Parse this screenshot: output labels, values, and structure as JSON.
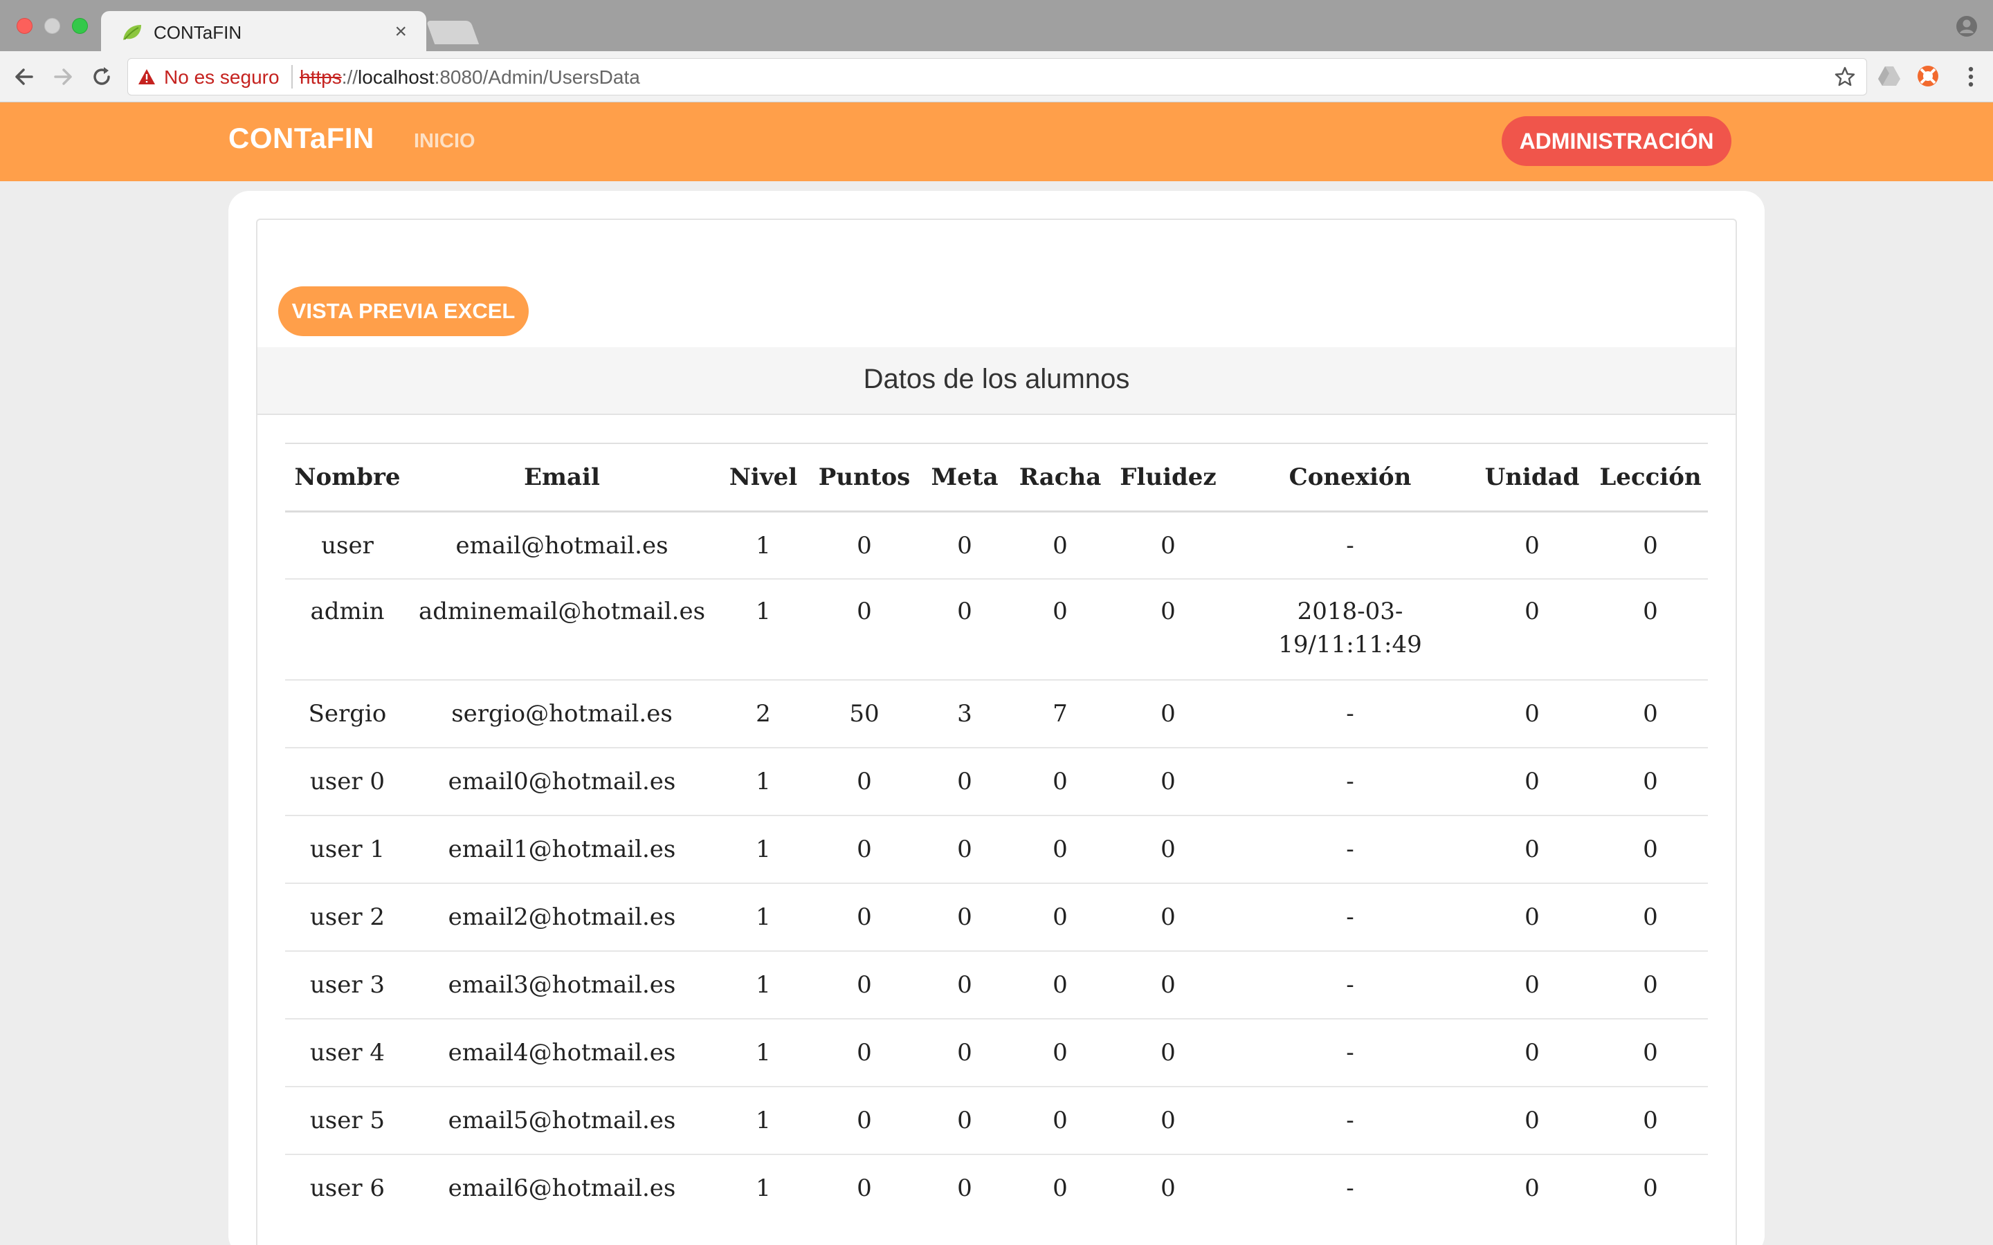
{
  "browser": {
    "tab_title": "CONTaFIN",
    "tab_close": "×",
    "security_label": "No es seguro",
    "url_scheme": "https",
    "url_sep": "://",
    "url_host": "localhost",
    "url_rest": ":8080/Admin/UsersData"
  },
  "nav": {
    "brand": "CONTaFIN",
    "inicio": "INICIO",
    "admin_button": "ADMINISTRACIÓN"
  },
  "content": {
    "excel_button": "VISTA PREVIA EXCEL",
    "table_title": "Datos de los alumnos"
  },
  "table": {
    "headers": [
      "Nombre",
      "Email",
      "Nivel",
      "Puntos",
      "Meta",
      "Racha",
      "Fluidez",
      "Conexión",
      "Unidad",
      "Lección"
    ],
    "rows": [
      [
        "user",
        "email@hotmail.es",
        "1",
        "0",
        "0",
        "0",
        "0",
        "-",
        "0",
        "0"
      ],
      [
        "admin",
        "adminemail@hotmail.es",
        "1",
        "0",
        "0",
        "0",
        "0",
        "2018-03-\n19/11:11:49",
        "0",
        "0"
      ],
      [
        "Sergio",
        "sergio@hotmail.es",
        "2",
        "50",
        "3",
        "7",
        "0",
        "-",
        "0",
        "0"
      ],
      [
        "user 0",
        "email0@hotmail.es",
        "1",
        "0",
        "0",
        "0",
        "0",
        "-",
        "0",
        "0"
      ],
      [
        "user 1",
        "email1@hotmail.es",
        "1",
        "0",
        "0",
        "0",
        "0",
        "-",
        "0",
        "0"
      ],
      [
        "user 2",
        "email2@hotmail.es",
        "1",
        "0",
        "0",
        "0",
        "0",
        "-",
        "0",
        "0"
      ],
      [
        "user 3",
        "email3@hotmail.es",
        "1",
        "0",
        "0",
        "0",
        "0",
        "-",
        "0",
        "0"
      ],
      [
        "user 4",
        "email4@hotmail.es",
        "1",
        "0",
        "0",
        "0",
        "0",
        "-",
        "0",
        "0"
      ],
      [
        "user 5",
        "email5@hotmail.es",
        "1",
        "0",
        "0",
        "0",
        "0",
        "-",
        "0",
        "0"
      ],
      [
        "user 6",
        "email6@hotmail.es",
        "1",
        "0",
        "0",
        "0",
        "0",
        "-",
        "0",
        "0"
      ]
    ]
  },
  "colors": {
    "accent_orange": "#ff9f4a",
    "admin_red": "#f0554b",
    "insecure_red": "#c5221f"
  }
}
